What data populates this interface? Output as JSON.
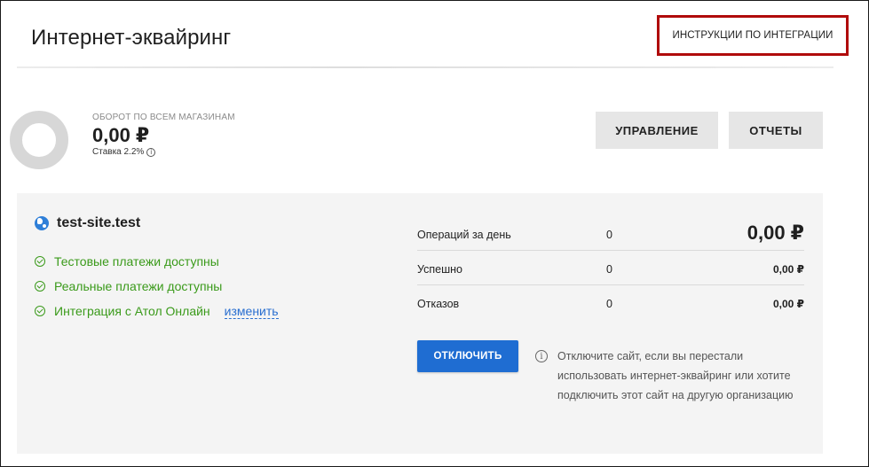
{
  "header": {
    "title": "Интернет-эквайринг",
    "instructions_button": "ИНСТРУКЦИИ ПО ИНТЕГРАЦИИ"
  },
  "summary": {
    "turnover_label": "ОБОРОТ ПО ВСЕМ МАГАЗИНАМ",
    "turnover_value": "0,00 ₽",
    "rate_text": "Ставка 2.2%",
    "info_glyph": "i"
  },
  "actions": {
    "manage_button": "УПРАВЛЕНИЕ",
    "reports_button": "ОТЧЕТЫ"
  },
  "site": {
    "name": "test-site.test",
    "icon": "globe-icon",
    "statuses": [
      {
        "text": "Тестовые платежи доступны"
      },
      {
        "text": "Реальные платежи доступны"
      },
      {
        "text": "Интеграция с Атол Онлайн",
        "link": "изменить"
      }
    ],
    "stats": [
      {
        "label": "Операций за день",
        "count": "0",
        "amount": "0,00 ₽"
      },
      {
        "label": "Успешно",
        "count": "0",
        "amount": "0,00 ₽"
      },
      {
        "label": "Отказов",
        "count": "0",
        "amount": "0,00 ₽"
      }
    ],
    "disable_button": "ОТКЛЮЧИТЬ",
    "hint_text": "Отключите сайт, если вы перестали использовать интернет-эквайринг или хотите подключить этот сайт на другую организацию"
  },
  "colors": {
    "accent_blue": "#1f6dd2",
    "status_green": "#3a9a1a",
    "highlight_red": "#b00b0b"
  }
}
